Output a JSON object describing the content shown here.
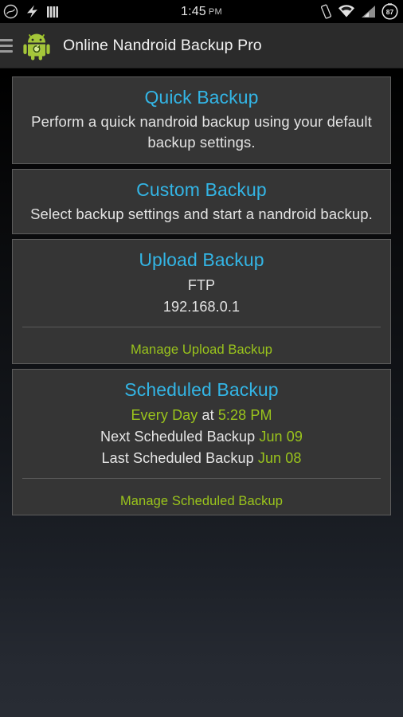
{
  "status_bar": {
    "icons_left": [
      "clock-circle-icon",
      "lightning-bolt-icon",
      "signal-bars-icon"
    ],
    "time": "1:45",
    "ampm": "PM",
    "icons_right": [
      "vibrate-icon",
      "wifi-icon",
      "cellular-signal-icon",
      "battery-icon"
    ],
    "battery_percent": "87"
  },
  "action_bar": {
    "drawer_icon": "hamburger-menu-icon",
    "logo_icon": "android-restore-logo-icon",
    "title": "Online Nandroid Backup Pro"
  },
  "colors": {
    "accent_blue": "#33b5e5",
    "accent_green": "#9ac41c",
    "card_bg": "#353535",
    "card_border": "#5d5d5d",
    "text_primary": "#e3e3e3",
    "action_bar_bg": "#2b2b2b"
  },
  "cards": {
    "quick_backup": {
      "title": "Quick Backup",
      "description": "Perform a quick nandroid backup using your default backup settings."
    },
    "custom_backup": {
      "title": "Custom Backup",
      "description": "Select backup settings and start a nandroid backup."
    },
    "upload_backup": {
      "title": "Upload Backup",
      "protocol": "FTP",
      "address": "192.168.0.1",
      "action_label": "Manage Upload Backup"
    },
    "scheduled_backup": {
      "title": "Scheduled Backup",
      "frequency": "Every Day",
      "at_label": "at",
      "time": "5:28 PM",
      "next_label": "Next Scheduled Backup",
      "next_value": "Jun 09",
      "last_label": "Last Scheduled Backup",
      "last_value": "Jun 08",
      "action_label": "Manage Scheduled Backup"
    }
  }
}
